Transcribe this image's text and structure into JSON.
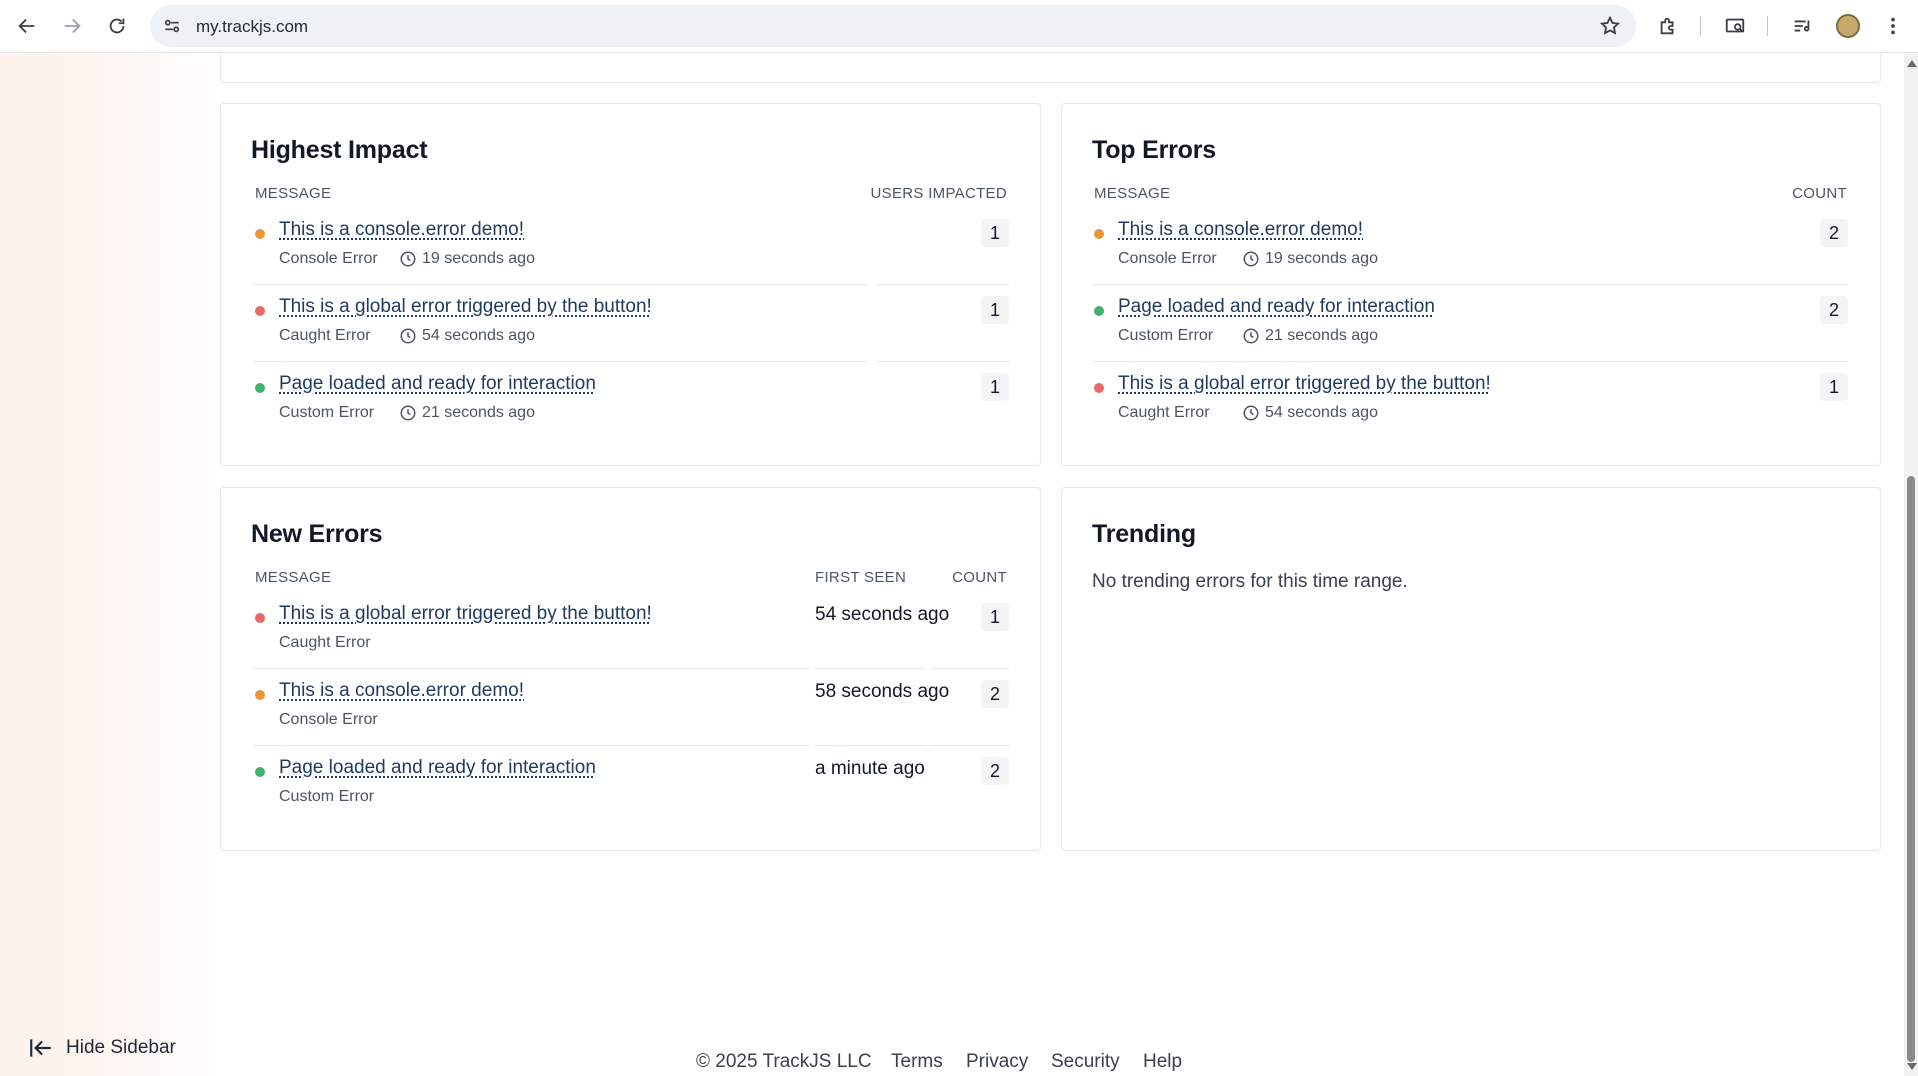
{
  "browser": {
    "url": "my.trackjs.com",
    "icons": [
      "back-icon",
      "forward-icon",
      "reload-icon",
      "site-info-icon",
      "star-icon",
      "extensions-icon",
      "media-router-icon",
      "reading-list-icon",
      "profile-avatar",
      "menu-icon"
    ]
  },
  "highest_impact": {
    "title": "Highest Impact",
    "col_message": "MESSAGE",
    "col_metric": "USERS IMPACTED",
    "rows": [
      {
        "message": "This is a console.error demo!",
        "type": "Console Error",
        "time": "19 seconds ago",
        "count": "1",
        "status": "orange"
      },
      {
        "message": "This is a global error triggered by the button!",
        "type": "Caught Error",
        "time": "54 seconds ago",
        "count": "1",
        "status": "red"
      },
      {
        "message": "Page loaded and ready for interaction",
        "type": "Custom Error",
        "time": "21 seconds ago",
        "count": "1",
        "status": "green"
      }
    ]
  },
  "top_errors": {
    "title": "Top Errors",
    "col_message": "MESSAGE",
    "col_metric": "COUNT",
    "rows": [
      {
        "message": "This is a console.error demo!",
        "type": "Console Error",
        "time": "19 seconds ago",
        "count": "2",
        "status": "orange"
      },
      {
        "message": "Page loaded and ready for interaction",
        "type": "Custom Error",
        "time": "21 seconds ago",
        "count": "2",
        "status": "green"
      },
      {
        "message": "This is a global error triggered by the button!",
        "type": "Caught Error",
        "time": "54 seconds ago",
        "count": "1",
        "status": "red"
      }
    ]
  },
  "new_errors": {
    "title": "New Errors",
    "col_message": "MESSAGE",
    "col_first_seen": "FIRST SEEN",
    "col_count": "COUNT",
    "rows": [
      {
        "message": "This is a global error triggered by the button!",
        "type": "Caught Error",
        "first_seen": "54 seconds ago",
        "count": "1",
        "status": "red"
      },
      {
        "message": "This is a console.error demo!",
        "type": "Console Error",
        "first_seen": "58 seconds ago",
        "count": "2",
        "status": "orange"
      },
      {
        "message": "Page loaded and ready for interaction",
        "type": "Custom Error",
        "first_seen": "a minute ago",
        "count": "2",
        "status": "green"
      }
    ]
  },
  "trending": {
    "title": "Trending",
    "empty_text": "No trending errors for this time range."
  },
  "footer": {
    "copyright": "© 2025 TrackJS LLC",
    "links": [
      "Terms",
      "Privacy",
      "Security",
      "Help"
    ]
  },
  "sidebar": {
    "hide_label": "Hide Sidebar"
  },
  "colors": {
    "orange": "#e8963a",
    "red": "#e5696b",
    "green": "#3fb36a",
    "link": "#1e3a5f"
  }
}
